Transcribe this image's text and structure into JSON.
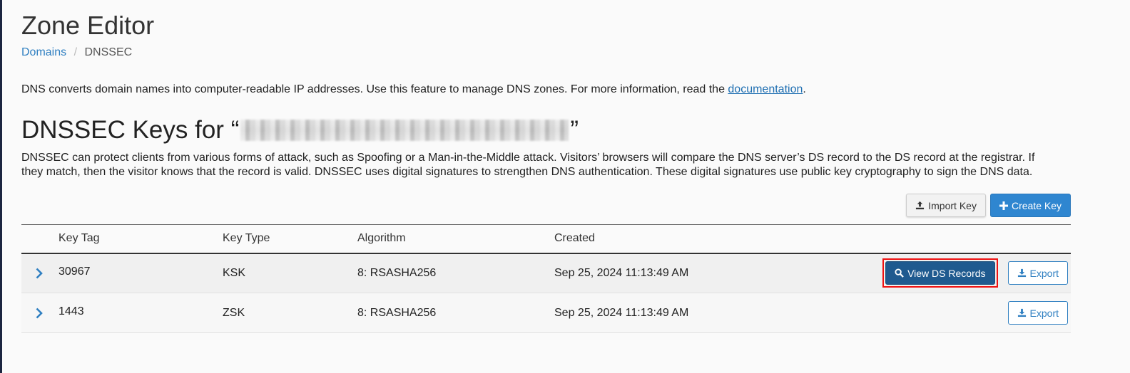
{
  "header": {
    "title": "Zone Editor",
    "breadcrumb": {
      "parent": "Domains",
      "separator": "/",
      "current": "DNSSEC"
    }
  },
  "intro": {
    "text": "DNS converts domain names into computer-readable IP addresses. Use this feature to manage DNS zones. For more information, read the ",
    "link": "documentation",
    "suffix": "."
  },
  "section": {
    "title_prefix": "DNSSEC Keys for “",
    "title_suffix": "”",
    "description": "DNSSEC can protect clients from various forms of attack, such as Spoofing or a Man-in-the-Middle attack. Visitors’ browsers will compare the DNS server’s DS record to the DS record at the registrar. If they match, then the visitor knows that the record is valid. DNSSEC uses digital signatures to strengthen DNS authentication. These digital signatures use public key cryptography to sign the DNS data."
  },
  "toolbar": {
    "import_label": "Import Key",
    "create_label": "Create Key"
  },
  "table": {
    "columns": [
      "Key Tag",
      "Key Type",
      "Algorithm",
      "Created"
    ],
    "rows": [
      {
        "key_tag": "30967",
        "key_type": "KSK",
        "algorithm": "8: RSASHA256",
        "created": "Sep 25, 2024 11:13:49 AM",
        "view_ds_label": "View DS Records",
        "export_label": "Export"
      },
      {
        "key_tag": "1443",
        "key_type": "ZSK",
        "algorithm": "8: RSASHA256",
        "created": "Sep 25, 2024 11:13:49 AM",
        "export_label": "Export"
      }
    ]
  },
  "icons": {
    "expand": "chevron-right-icon",
    "import": "upload-icon",
    "create": "plus-icon",
    "view": "search-icon",
    "export": "download-icon"
  },
  "colors": {
    "link": "#2f7fc1",
    "primary": "#2f86d0",
    "dark_primary": "#1f5a8f",
    "highlight": "#ee1111"
  }
}
